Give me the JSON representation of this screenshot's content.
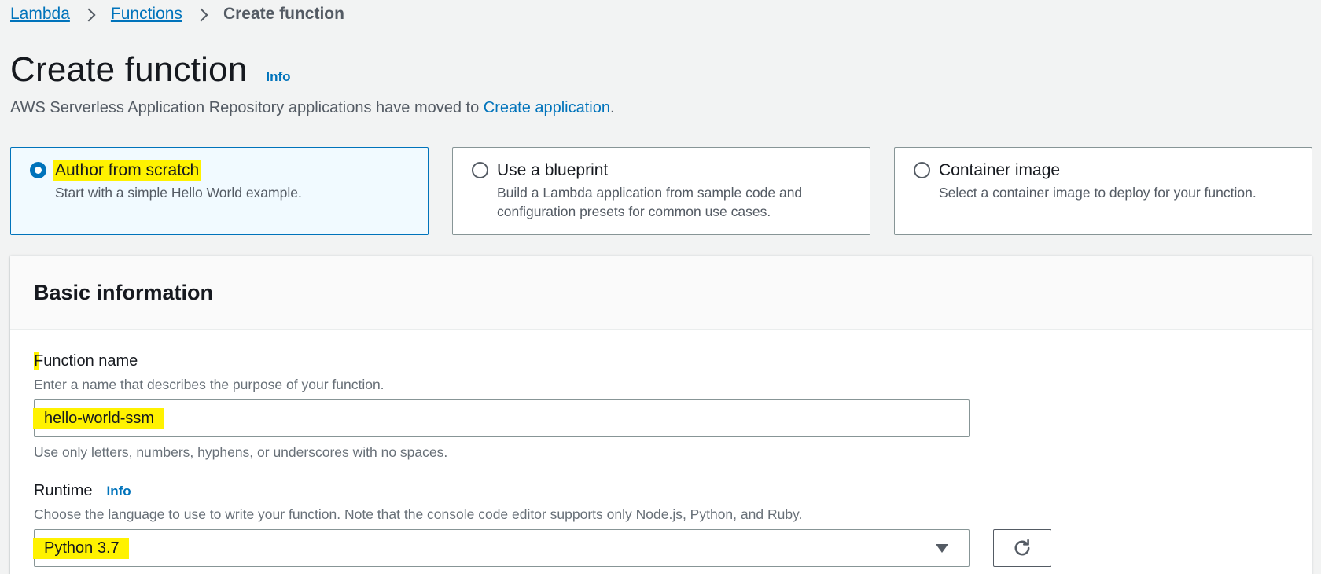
{
  "breadcrumb": {
    "items": [
      {
        "label": "Lambda"
      },
      {
        "label": "Functions"
      }
    ],
    "current": "Create function"
  },
  "header": {
    "title": "Create function",
    "info_label": "Info",
    "subtitle_prefix": "AWS Serverless Application Repository applications have moved to ",
    "subtitle_link": "Create application",
    "subtitle_suffix": "."
  },
  "options": [
    {
      "title": "Author from scratch",
      "description": "Start with a simple Hello World example.",
      "selected": true
    },
    {
      "title": "Use a blueprint",
      "description": "Build a Lambda application from sample code and configuration presets for common use cases.",
      "selected": false
    },
    {
      "title": "Container image",
      "description": "Select a container image to deploy for your function.",
      "selected": false
    }
  ],
  "basic_info": {
    "title": "Basic information",
    "function_name": {
      "label": "Function name",
      "description": "Enter a name that describes the purpose of your function.",
      "value": "hello-world-ssm",
      "constraint": "Use only letters, numbers, hyphens, or underscores with no spaces."
    },
    "runtime": {
      "label": "Runtime",
      "info_label": "Info",
      "description": "Choose the language to use to write your function. Note that the console code editor supports only Node.js, Python, and Ruby.",
      "value": "Python 3.7"
    }
  },
  "icons": {
    "breadcrumb_separator": "chevron-right-icon",
    "select_caret": "caret-down-icon",
    "refresh": "refresh-icon"
  },
  "colors": {
    "link": "#0073bb",
    "highlight": "#fff200",
    "selected_tile_bg": "#f1faff"
  }
}
